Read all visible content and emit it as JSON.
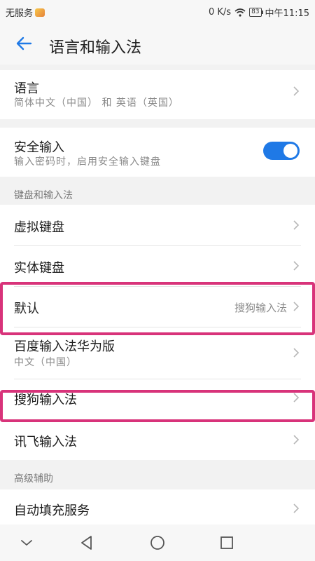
{
  "status_bar": {
    "carrier": "无服务",
    "speed": "0 K/s",
    "battery": "83",
    "time": "中午11:15"
  },
  "header": {
    "title": "语言和输入法"
  },
  "language": {
    "label": "语言",
    "value": "简体中文（中国） 和 英语（英国）"
  },
  "secure_input": {
    "label": "安全输入",
    "description": "输入密码时，启用安全输入键盘",
    "enabled": true
  },
  "keyboard_section": {
    "header": "键盘和输入法",
    "items": [
      {
        "label": "虚拟键盘"
      },
      {
        "label": "实体键盘"
      },
      {
        "label": "默认",
        "value": "搜狗输入法"
      },
      {
        "label": "百度输入法华为版",
        "sub": "中文（中国）"
      },
      {
        "label": "搜狗输入法"
      },
      {
        "label": "讯飞输入法"
      }
    ]
  },
  "advanced_section": {
    "header": "高级辅助",
    "items": [
      {
        "label": "自动填充服务"
      }
    ]
  },
  "colors": {
    "accent": "#1f79e6",
    "highlight": "#d8337a"
  },
  "icons": [
    "back-arrow-icon",
    "wifi-icon",
    "battery-icon",
    "chevron-right-icon",
    "nav-back-icon",
    "nav-home-icon",
    "nav-recent-icon",
    "nav-collapse-icon"
  ]
}
